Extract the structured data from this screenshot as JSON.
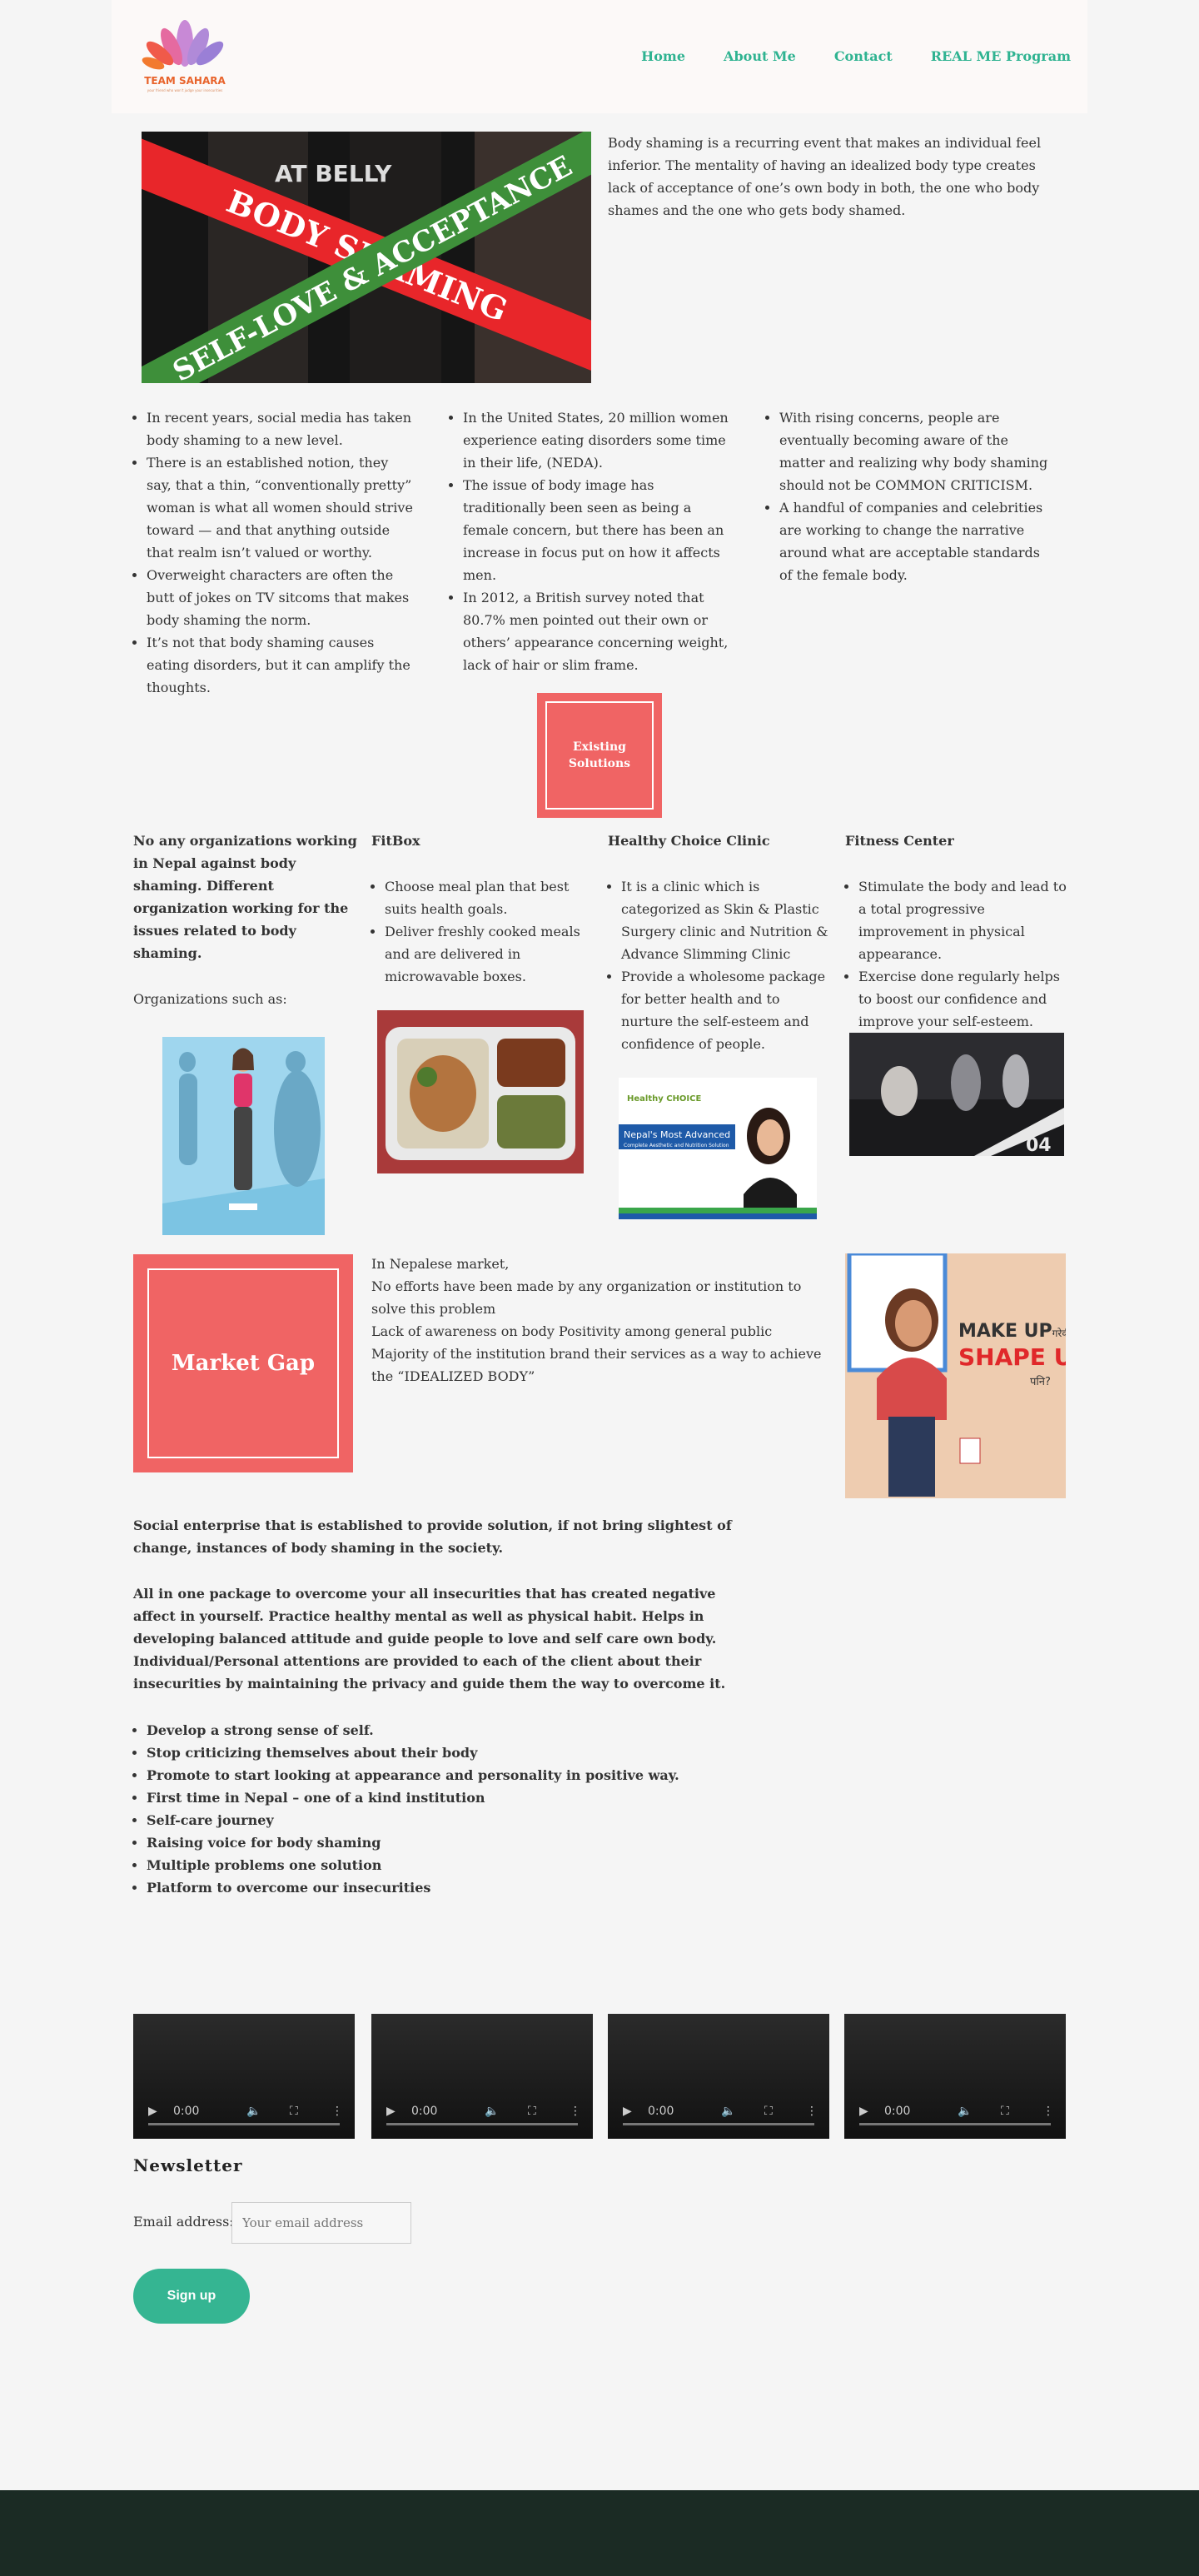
{
  "brand": {
    "name": "TEAM SAHARA",
    "tagline": "your friend who won't judge your insecurities"
  },
  "nav": [
    "Home",
    "About Me",
    "Contact",
    "REAL ME Program"
  ],
  "hero": {
    "image_text_1": "BODY SHAMING",
    "image_text_2": "SELF-LOVE & ACCEPTANCE",
    "image_text_3": "AT BELLY",
    "paragraph": "Body shaming is a recurring event that makes an individual feel inferior. The mentality of having an idealized body type creates lack of acceptance of one’s own body in both, the one who body shames and the one who gets body shamed."
  },
  "columns": [
    [
      "In recent years, social media has taken body shaming to a new level.",
      "There is an established notion, they say, that a thin, “conventionally pretty” woman is what all women should strive toward — and that anything outside that realm isn’t valued or worthy.",
      "Overweight characters are often the butt of jokes on TV sitcoms that makes body shaming the norm.",
      "It’s not that body shaming causes eating disorders, but it can amplify the thoughts."
    ],
    [
      "In the United States, 20 million women experience eating disorders some time in their life, (NEDA).",
      "The issue of body image has traditionally been seen as being a female concern, but there has been an increase in focus put on how it affects men.",
      "In 2012, a British survey noted that 80.7% men pointed out their own or others’ appearance concerning weight, lack of hair or slim frame."
    ],
    [
      "With rising concerns, people are eventually becoming aware of the matter and  realizing why body shaming should not be COMMON CRITICISM.",
      "A handful of companies and celebrities are working to change the narrative around what are acceptable standards of the female body."
    ]
  ],
  "existing_solutions": "Existing Solutions",
  "orgs": {
    "intro_bold": "No any organizations working in Nepal against body shaming. Different organization working for the issues related to body shaming.",
    "intro_plain": "Organizations such as:",
    "fitbox": {
      "title": "FitBox",
      "items": [
        "Choose meal plan that best suits health goals.",
        "Deliver freshly cooked meals and are delivered in microwavable boxes."
      ]
    },
    "clinic": {
      "title": "Healthy Choice Clinic",
      "items": [
        "It is a clinic which is categorized as Skin & Plastic Surgery clinic and Nutrition & Advance Slimming Clinic",
        "Provide a wholesome package for better health and to nurture the self-esteem and confidence of people."
      ],
      "ad_logo": "Healthy CHOICE",
      "ad_title": "Nepal's Most Advanced",
      "ad_sub": "Complete Aesthetic and Nutrition Solution"
    },
    "fitness": {
      "title": "Fitness Center",
      "items": [
        "Stimulate the body and lead to a total progressive improvement in physical appearance.",
        "Exercise done regularly helps to boost our confidence and improve your self-esteem."
      ],
      "img_number": "04"
    }
  },
  "market_gap": {
    "title": "Market Gap",
    "lines": [
      "In Nepalese market,",
      "No efforts have been made by any organization or institution to solve this problem",
      "Lack of awareness on body Positivity among general public",
      "Majority of the institution brand their services as a way to achieve the “IDEALIZED BODY”"
    ],
    "poster_line1": "MAKE UP",
    "poster_suffix1": "गरेकी",
    "poster_line2": "SHAPE UP",
    "poster_suffix2": "पनि?"
  },
  "enterprise": {
    "p1": "Social enterprise that is established to provide solution, if not bring slightest of change, instances of body shaming in the society.",
    "p2": "All in one package to overcome your all insecurities that has created negative affect in yourself. Practice healthy mental as well as physical habit. Helps in developing balanced attitude and guide people to love and self care own body. Individual/Personal attentions are provided to each of the client about their insecurities by maintaining the privacy and guide them the way to overcome it.",
    "list": [
      "Develop a strong sense of self.",
      "Stop criticizing themselves about their body",
      "Promote to start looking at appearance and personality in positive way.",
      "First time in Nepal – one of a kind institution",
      "Self-care journey",
      "Raising voice for body shaming",
      "Multiple problems one solution",
      "Platform to overcome our insecurities"
    ]
  },
  "videos": [
    {
      "time": "0:00"
    },
    {
      "time": "0:00"
    },
    {
      "time": "0:00"
    },
    {
      "time": "0:00"
    }
  ],
  "newsletter": {
    "title": "Newsletter",
    "label": "Email address:",
    "placeholder": "Your email address",
    "button": "Sign up"
  }
}
